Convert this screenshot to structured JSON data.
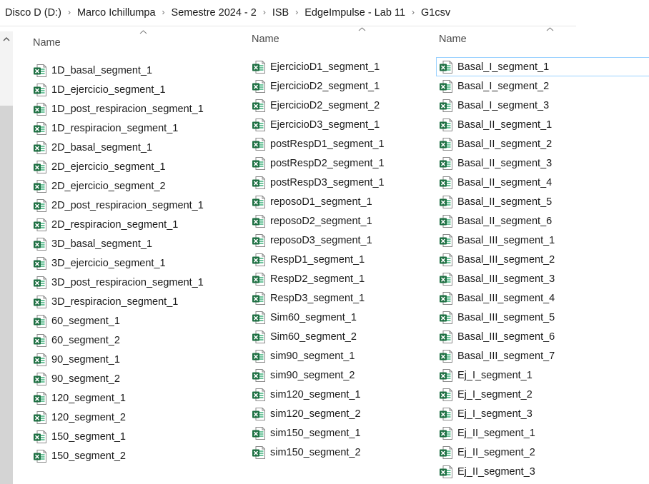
{
  "breadcrumb": [
    "Disco D (D:)",
    "Marco Ichillumpa",
    "Semestre 2024 - 2",
    "ISB",
    "EdgeImpulse - Lab 11",
    "G1csv"
  ],
  "columns": [
    {
      "header": "Name",
      "files": [
        "1D_basal_segment_1",
        "1D_ejercicio_segment_1",
        "1D_post_respiracion_segment_1",
        "1D_respiracion_segment_1",
        "2D_basal_segment_1",
        "2D_ejercicio_segment_1",
        "2D_ejercicio_segment_2",
        "2D_post_respiracion_segment_1",
        "2D_respiracion_segment_1",
        "3D_basal_segment_1",
        "3D_ejercicio_segment_1",
        "3D_post_respiracion_segment_1",
        "3D_respiracion_segment_1",
        "60_segment_1",
        "60_segment_2",
        "90_segment_1",
        "90_segment_2",
        "120_segment_1",
        "120_segment_2",
        "150_segment_1",
        "150_segment_2"
      ]
    },
    {
      "header": "Name",
      "files": [
        "EjercicioD1_segment_1",
        "EjercicioD2_segment_1",
        "EjercicioD2_segment_2",
        "EjercicioD3_segment_1",
        "postRespD1_segment_1",
        "postRespD2_segment_1",
        "postRespD3_segment_1",
        "reposoD1_segment_1",
        "reposoD2_segment_1",
        "reposoD3_segment_1",
        "RespD1_segment_1",
        "RespD2_segment_1",
        "RespD3_segment_1",
        "Sim60_segment_1",
        "Sim60_segment_2",
        "sim90_segment_1",
        "sim90_segment_2",
        "sim120_segment_1",
        "sim120_segment_2",
        "sim150_segment_1",
        "sim150_segment_2"
      ]
    },
    {
      "header": "Name",
      "files": [
        "Basal_I_segment_1",
        "Basal_I_segment_2",
        "Basal_I_segment_3",
        "Basal_II_segment_1",
        "Basal_II_segment_2",
        "Basal_II_segment_3",
        "Basal_II_segment_4",
        "Basal_II_segment_5",
        "Basal_II_segment_6",
        "Basal_III_segment_1",
        "Basal_III_segment_2",
        "Basal_III_segment_3",
        "Basal_III_segment_4",
        "Basal_III_segment_5",
        "Basal_III_segment_6",
        "Basal_III_segment_7",
        "Ej_I_segment_1",
        "Ej_I_segment_2",
        "Ej_I_segment_3",
        "Ej_II_segment_1",
        "Ej_II_segment_2",
        "Ej_II_segment_3"
      ]
    }
  ],
  "selected_file": "Basal_I_segment_1",
  "file_icon": "excel-csv-icon",
  "colors": {
    "excel_green": "#1d6f42",
    "selection_border": "#99d1ff"
  }
}
